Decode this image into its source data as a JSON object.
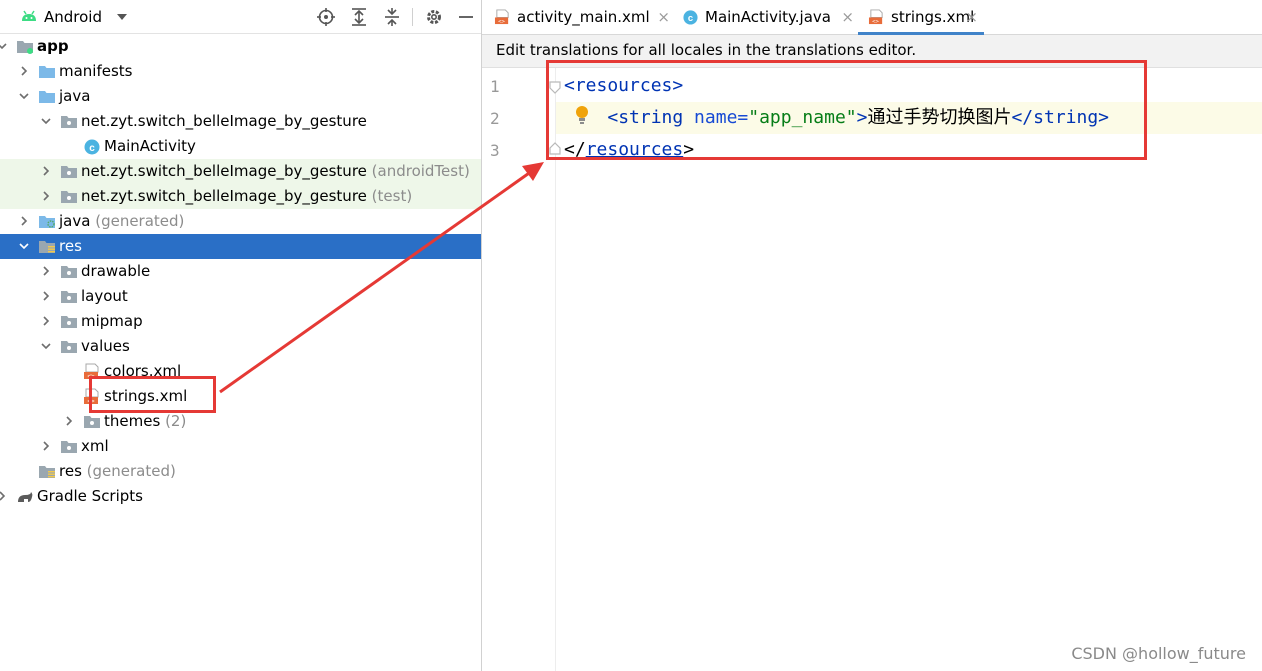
{
  "project_panel": {
    "view_label": "Android",
    "toolbar_icons": [
      "locate-icon",
      "expand-all-icon",
      "collapse-all-icon",
      "gear-icon",
      "minimize-icon"
    ]
  },
  "tree": [
    {
      "label": "app",
      "hint": "",
      "indent": 0,
      "arrow": "down",
      "icon": "module-icon",
      "bold": true
    },
    {
      "label": "manifests",
      "hint": "",
      "indent": 1,
      "arrow": "right",
      "icon": "folder-icon"
    },
    {
      "label": "java",
      "hint": "",
      "indent": 1,
      "arrow": "down",
      "icon": "folder-icon"
    },
    {
      "label": "net.zyt.switch_belleImage_by_gesture",
      "hint": "",
      "indent": 2,
      "arrow": "down",
      "icon": "package-icon"
    },
    {
      "label": "MainActivity",
      "hint": "",
      "indent": 3,
      "arrow": "",
      "icon": "class-icon"
    },
    {
      "label": "net.zyt.switch_belleImage_by_gesture",
      "hint": "(androidTest)",
      "indent": 2,
      "arrow": "right",
      "icon": "package-icon",
      "tint": true
    },
    {
      "label": "net.zyt.switch_belleImage_by_gesture",
      "hint": "(test)",
      "indent": 2,
      "arrow": "right",
      "icon": "package-icon",
      "tint": true
    },
    {
      "label": "java",
      "hint": "(generated)",
      "indent": 1,
      "arrow": "right",
      "icon": "generated-folder-icon"
    },
    {
      "label": "res",
      "hint": "",
      "indent": 1,
      "arrow": "down",
      "icon": "res-folder-icon",
      "selected": true
    },
    {
      "label": "drawable",
      "hint": "",
      "indent": 2,
      "arrow": "right",
      "icon": "package-icon"
    },
    {
      "label": "layout",
      "hint": "",
      "indent": 2,
      "arrow": "right",
      "icon": "package-icon"
    },
    {
      "label": "mipmap",
      "hint": "",
      "indent": 2,
      "arrow": "right",
      "icon": "package-icon"
    },
    {
      "label": "values",
      "hint": "",
      "indent": 2,
      "arrow": "down",
      "icon": "package-icon"
    },
    {
      "label": "colors.xml",
      "hint": "",
      "indent": 3,
      "arrow": "",
      "icon": "xml-file-icon"
    },
    {
      "label": "strings.xml",
      "hint": "",
      "indent": 3,
      "arrow": "",
      "icon": "xml-file-icon"
    },
    {
      "label": "themes",
      "hint": "(2)",
      "indent": 3,
      "arrow": "right",
      "icon": "package-icon"
    },
    {
      "label": "xml",
      "hint": "",
      "indent": 2,
      "arrow": "right",
      "icon": "package-icon"
    },
    {
      "label": "res",
      "hint": "(generated)",
      "indent": 1,
      "arrow": "",
      "icon": "res-folder-icon"
    },
    {
      "label": "Gradle Scripts",
      "hint": "",
      "indent": 0,
      "arrow": "right",
      "icon": "gradle-icon"
    }
  ],
  "editor": {
    "tabs": [
      {
        "label": "activity_main.xml",
        "icon": "xml-file-icon",
        "close": "×"
      },
      {
        "label": "MainActivity.java",
        "icon": "class-icon",
        "close": "×"
      },
      {
        "label": "strings.xml",
        "icon": "xml-file-icon",
        "close": "×",
        "active": true
      }
    ],
    "banner": "Edit translations for all locales in the translations editor.",
    "line_numbers": [
      "1",
      "2",
      "3"
    ],
    "code": {
      "l1_open": "<resources>",
      "l2_indent": "    ",
      "l2_tag_open": "<string",
      "l2_attr": " name=",
      "l2_value": "\"app_name\"",
      "l2_gt": ">",
      "l2_text": "通过手势切换图片",
      "l2_close": "</string>",
      "l3_lt": "</",
      "l3_tag": "resources",
      "l3_gt": ">"
    }
  },
  "watermark": "CSDN @hollow_future",
  "colors": {
    "selection": "#2a6fc6",
    "annotation_red": "#e53935",
    "tab_active_underline": "#4083c9"
  }
}
